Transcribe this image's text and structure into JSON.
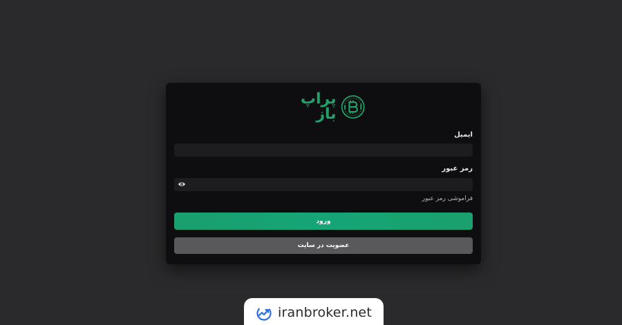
{
  "brand": {
    "name": "پراپ باز",
    "accent": "#1fa36a"
  },
  "form": {
    "email_label": "ایمیل",
    "email_value": "",
    "password_label": "رمز عبور",
    "password_value": "",
    "forgot_link": "فراموشی رمز عبور",
    "login_button": "ورود",
    "register_button": "عضویت در سایت"
  },
  "icons": {
    "logo": "bitcoin-candles-logo",
    "password_toggle": "eye-icon",
    "watermark": "chart-trend-icon"
  },
  "watermark": {
    "text": "iranbroker.net"
  }
}
